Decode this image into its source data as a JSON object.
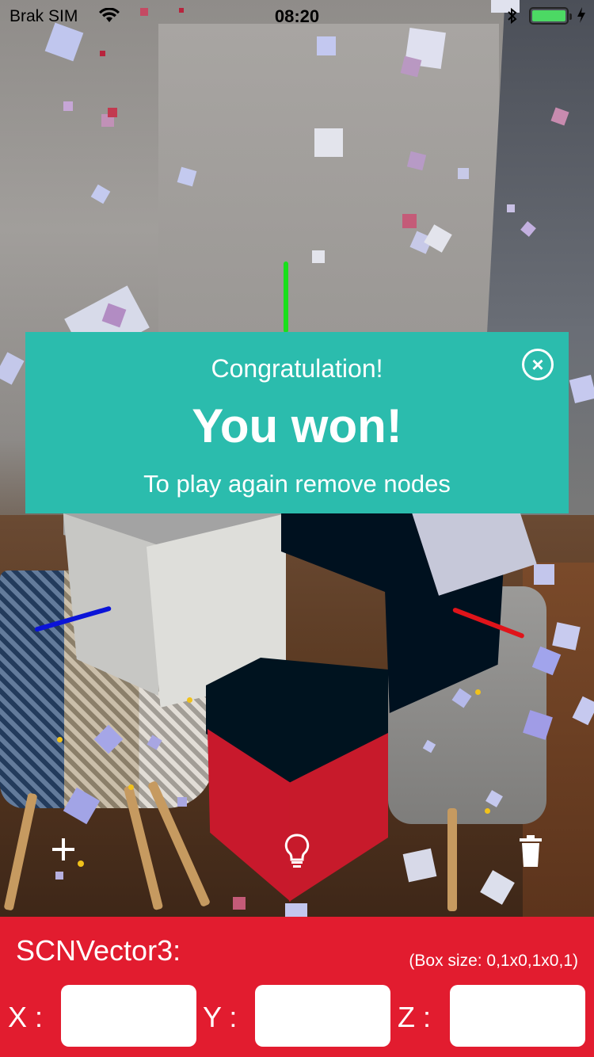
{
  "status_bar": {
    "carrier": "Brak SIM",
    "time": "08:20",
    "battery_level": 1.0,
    "wifi_icon": "wifi-icon",
    "bluetooth_icon": "bluetooth-icon",
    "charging_icon": "charging-bolt-icon"
  },
  "win_banner": {
    "greeting": "Congratulation!",
    "headline": "You won!",
    "instruction": "To play again remove nodes",
    "close_icon": "close-circle-icon",
    "background_color": "#2bbcad"
  },
  "toolbar": {
    "add_icon": "plus-icon",
    "hint_icon": "lightbulb-icon",
    "delete_icon": "trash-icon"
  },
  "vector_panel": {
    "title": "SCNVector3:",
    "box_size_note": "(Box size: 0,1x0,1x0,1)",
    "x_label": "X :",
    "y_label": "Y :",
    "z_label": "Z :",
    "x_value": "",
    "y_value": "",
    "z_value": "",
    "background_color": "#e21c2f"
  },
  "scene": {
    "block_colors": {
      "white_block": "#dededa",
      "navy_block": "#00111f",
      "red_block": "#c8192c"
    },
    "axis_colors": {
      "y_axis": "#19e01b",
      "z_axis": "#0b14d8",
      "x_axis": "#e0141a"
    }
  }
}
